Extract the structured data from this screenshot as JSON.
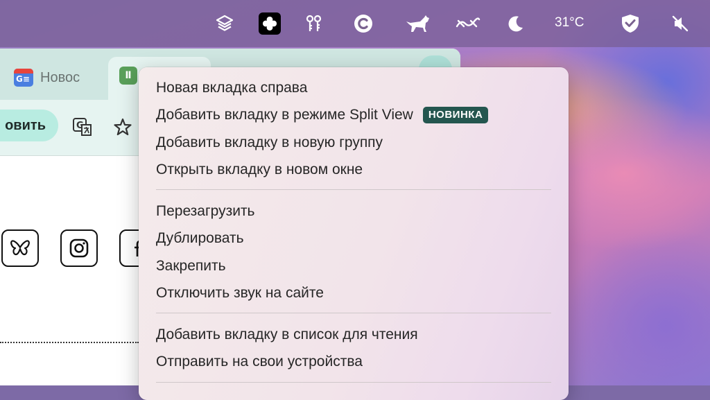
{
  "menubar": {
    "temperature": "31°C",
    "icons": [
      "layers-icon",
      "app-clover-icon",
      "keys-icon",
      "c-circle-icon",
      "cat-icon",
      "wave-icon",
      "moon-icon",
      "shield-check-icon",
      "speaker-muted-icon"
    ]
  },
  "browser": {
    "tabs": [
      {
        "label": "Новос"
      },
      {
        "label": ""
      }
    ],
    "toolbar": {
      "install_label": "овить"
    }
  },
  "context_menu": {
    "items": [
      {
        "label": "Новая вкладка справа"
      },
      {
        "label": "Добавить вкладку в режиме Split View",
        "badge": "НОВИНКА"
      },
      {
        "label": "Добавить вкладку в новую группу"
      },
      {
        "label": "Открыть вкладку в новом окне"
      },
      {
        "label": "Перезагрузить"
      },
      {
        "label": "Дублировать"
      },
      {
        "label": "Закрепить"
      },
      {
        "label": "Отключить звук на сайте"
      },
      {
        "label": "Добавить вкладку в список для чтения"
      },
      {
        "label": "Отправить на свои устройства"
      }
    ]
  },
  "colors": {
    "badge_bg": "#24564f",
    "tab_strip": "#cfe6e1",
    "toolbar": "#e6f4f1"
  }
}
